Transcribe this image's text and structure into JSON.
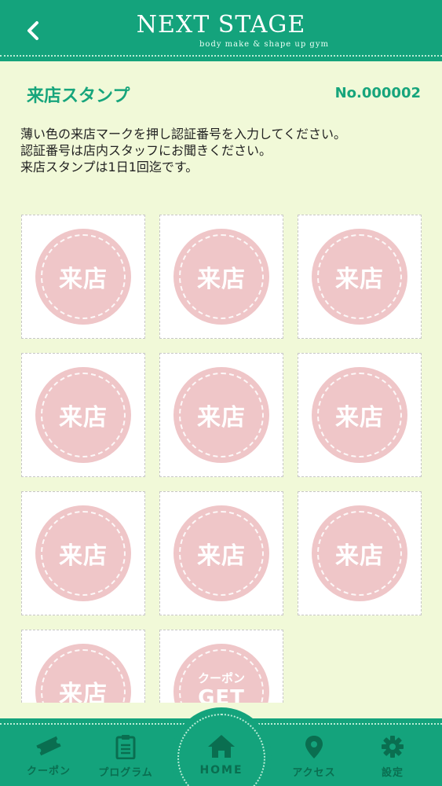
{
  "header": {
    "title": "NEXT STAGE",
    "subtitle": "body make & shape up gym",
    "back_icon": "chevron-left-icon"
  },
  "page": {
    "title": "来店スタンプ",
    "card_number": "No.000002",
    "instructions": [
      "薄い色の来店マークを押し認証番号を入力してください。",
      "認証番号は店内スタッフにお聞きください。",
      "来店スタンプは1日1回迄です。"
    ]
  },
  "stamps": {
    "visit_label": "来店",
    "coupon_label_top": "クーポン",
    "coupon_label_bottom": "GET",
    "cells": [
      "来店",
      "来店",
      "来店",
      "来店",
      "来店",
      "来店",
      "来店",
      "来店",
      "来店",
      "来店",
      "coupon"
    ]
  },
  "tabbar": {
    "items": [
      {
        "label": "クーポン",
        "icon": "ticket-icon"
      },
      {
        "label": "プログラム",
        "icon": "clipboard-icon"
      },
      {
        "label": "HOME",
        "icon": "home-icon"
      },
      {
        "label": "アクセス",
        "icon": "map-pin-icon"
      },
      {
        "label": "設定",
        "icon": "gear-icon"
      }
    ]
  },
  "colors": {
    "brand_green": "#14a37c",
    "background": "#f1f9d8",
    "stamp_pink": "#efc6c8",
    "tab_text": "#0a6e50"
  }
}
